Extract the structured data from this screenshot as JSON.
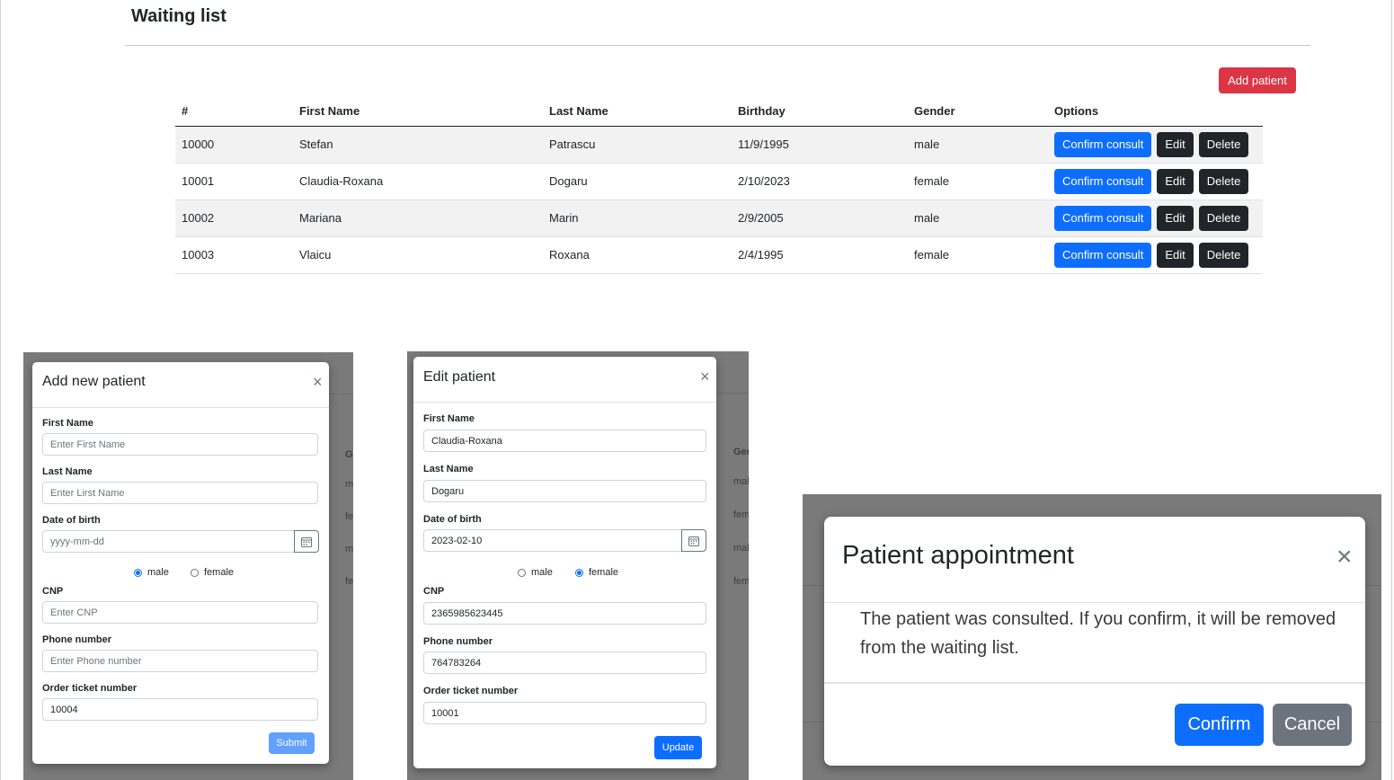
{
  "page": {
    "title": "Waiting list",
    "add_patient_label": "Add patient"
  },
  "table": {
    "headers": [
      "#",
      "First Name",
      "Last Name",
      "Birthday",
      "Gender",
      "Options"
    ],
    "rows": [
      {
        "id": "10000",
        "first": "Stefan",
        "last": "Patrascu",
        "birthday": "11/9/1995",
        "gender": "male"
      },
      {
        "id": "10001",
        "first": "Claudia-Roxana",
        "last": "Dogaru",
        "birthday": "2/10/2023",
        "gender": "female"
      },
      {
        "id": "10002",
        "first": "Mariana",
        "last": "Marin",
        "birthday": "2/9/2005",
        "gender": "male"
      },
      {
        "id": "10003",
        "first": "Vlaicu",
        "last": "Roxana",
        "birthday": "2/4/1995",
        "gender": "female"
      }
    ],
    "confirm_label": "Confirm consult",
    "edit_label": "Edit",
    "delete_label": "Delete"
  },
  "add_modal": {
    "title": "Add new patient",
    "close": "×",
    "first_name_label": "First Name",
    "first_name_placeholder": "Enter First Name",
    "last_name_label": "Last Name",
    "last_name_placeholder": "Enter Lirst Name",
    "dob_label": "Date of birth",
    "dob_placeholder": "yyyy-mm-dd",
    "male_label": "male",
    "female_label": "female",
    "cnp_label": "CNP",
    "cnp_placeholder": "Enter CNP",
    "phone_label": "Phone number",
    "phone_placeholder": "Enter Phone number",
    "ticket_label": "Order ticket number",
    "ticket_value": "10004",
    "submit_label": "Submit",
    "bg_fragments": [
      "Ge",
      "m",
      "fe",
      "m",
      "fe"
    ]
  },
  "edit_modal": {
    "title": "Edit patient",
    "close": "×",
    "first_name_label": "First Name",
    "first_name_value": "Claudia-Roxana",
    "last_name_label": "Last Name",
    "last_name_value": "Dogaru",
    "dob_label": "Date of birth",
    "dob_value": "2023-02-10",
    "male_label": "male",
    "female_label": "female",
    "cnp_label": "CNP",
    "cnp_value": "2365985623445",
    "phone_label": "Phone number",
    "phone_value": "764783264",
    "ticket_label": "Order ticket number",
    "ticket_value": "10001",
    "update_label": "Update",
    "bg_fragments": [
      "Ger",
      "mal",
      "fem",
      "mal",
      "fem"
    ]
  },
  "confirm_modal": {
    "title": "Patient appointment",
    "close": "×",
    "message": "The patient was consulted. If you confirm, it will be removed from the waiting list.",
    "confirm_label": "Confirm",
    "cancel_label": "Cancel"
  },
  "colors": {
    "primary": "#0d6efd",
    "danger": "#dc3545",
    "dark": "#212529",
    "secondary": "#6c757d"
  }
}
